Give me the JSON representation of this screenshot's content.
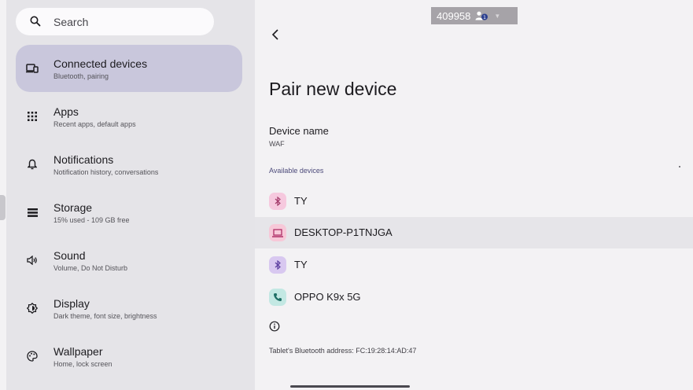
{
  "search": {
    "label": "Search"
  },
  "nav": {
    "items": [
      {
        "title": "Connected devices",
        "subtitle": "Bluetooth, pairing",
        "icon": "devices-icon",
        "selected": true
      },
      {
        "title": "Apps",
        "subtitle": "Recent apps, default apps",
        "icon": "apps-grid-icon"
      },
      {
        "title": "Notifications",
        "subtitle": "Notification history, conversations",
        "icon": "bell-icon"
      },
      {
        "title": "Storage",
        "subtitle": "15% used - 109 GB free",
        "icon": "storage-icon"
      },
      {
        "title": "Sound",
        "subtitle": "Volume, Do Not Disturb",
        "icon": "speaker-icon"
      },
      {
        "title": "Display",
        "subtitle": "Dark theme, font size, brightness",
        "icon": "brightness-icon"
      },
      {
        "title": "Wallpaper",
        "subtitle": "Home, lock screen",
        "icon": "palette-icon"
      }
    ]
  },
  "topbar": {
    "badge_text": "409958",
    "badge_count": "1"
  },
  "page": {
    "title": "Pair new device",
    "device_name_label": "Device name",
    "device_name_value": "WAF",
    "available_header": "Available devices"
  },
  "devices": [
    {
      "name": "TY",
      "icon": "bluetooth-icon",
      "color": "#f6c9de",
      "icon_color": "#a33a6a"
    },
    {
      "name": "DESKTOP-P1TNJGA",
      "icon": "laptop-icon",
      "color": "#f7c8d8",
      "icon_color": "#b03068",
      "highlighted": true
    },
    {
      "name": "TY",
      "icon": "bluetooth-icon",
      "color": "#d8c8f0",
      "icon_color": "#5d3fa0"
    },
    {
      "name": "OPPO K9x 5G",
      "icon": "phone-icon",
      "color": "#c3e8e3",
      "icon_color": "#1f6f66"
    }
  ],
  "footer": {
    "bt_address": "Tablet's Bluetooth address: FC:19:28:14:AD:47"
  },
  "colors": {
    "selected_nav": "#c9c7dc",
    "accent_header": "#4c4a7a"
  }
}
